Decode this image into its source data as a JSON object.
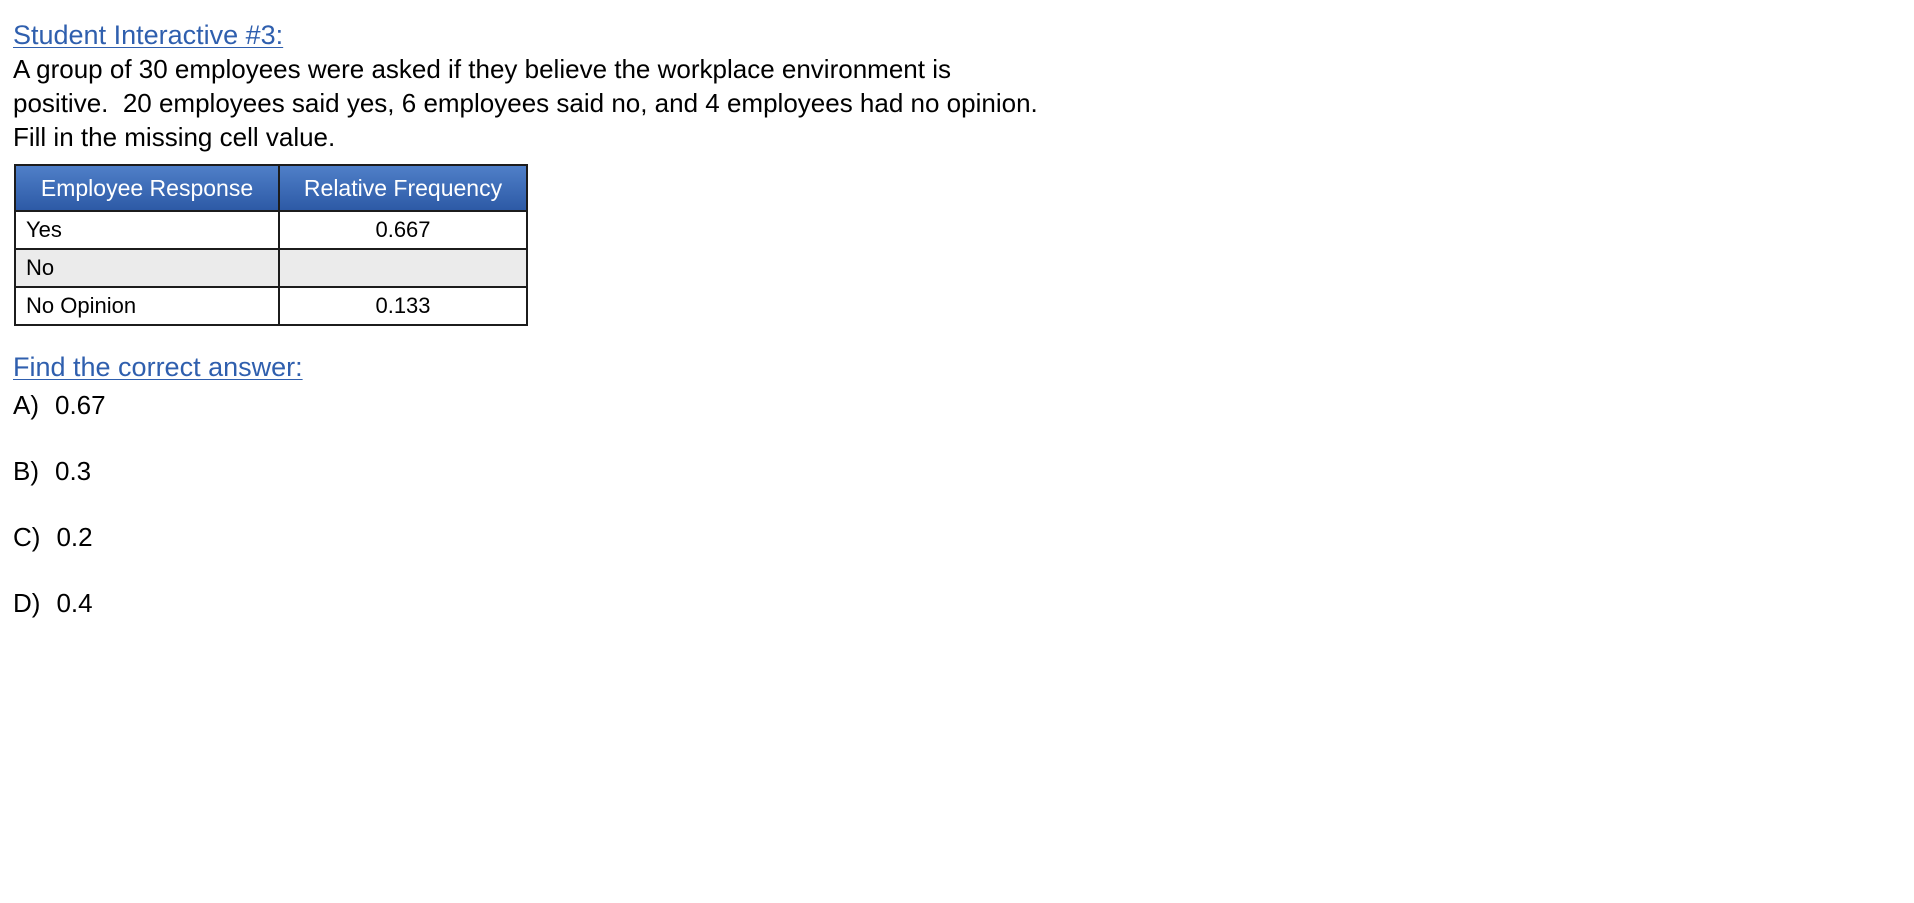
{
  "interactive_title": "Student Interactive #3:",
  "question": "A group of 30 employees were asked if they believe the workplace environment is positive.  20 employees said yes, 6 employees said no, and 4 employees had no opinion.  Fill in the missing cell value.",
  "table": {
    "headers": [
      "Employee Response",
      "Relative Frequency"
    ],
    "rows": [
      {
        "response": "Yes",
        "frequency": "0.667"
      },
      {
        "response": "No",
        "frequency": ""
      },
      {
        "response": "No Opinion",
        "frequency": "0.133"
      }
    ],
    "header_color": "#2d5aa6",
    "shaded_row_color": "#ebebeb"
  },
  "answer_prompt": "Find the correct answer:",
  "choices": [
    {
      "letter": "A)",
      "value": "0.67"
    },
    {
      "letter": "B)",
      "value": "0.3"
    },
    {
      "letter": "C)",
      "value": "0.2"
    },
    {
      "letter": "D)",
      "value": "0.4"
    }
  ],
  "colors": {
    "heading": "#2f5fae",
    "text": "#000000"
  }
}
